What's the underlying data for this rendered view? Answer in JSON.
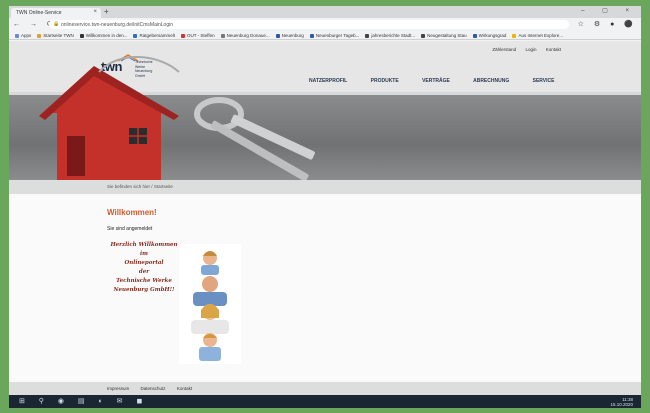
{
  "browser": {
    "tab_title": "TWN Online-Service",
    "new_tab": "+",
    "tab_close": "×",
    "window_controls": "– ▢ ×",
    "nav_icons": "← → ⟳ ⌂",
    "url": "onlineservice.twn-neuenburg.de/initCmsMainLogin",
    "extension_icons": "☆ ⚙ ● ⚫",
    "bookmarks": [
      {
        "label": "Apps",
        "color": "#6b8bd6"
      },
      {
        "label": "Startseite TWN",
        "color": "#e0a030"
      },
      {
        "label": "Willkommen in den...",
        "color": "#333333"
      },
      {
        "label": "Ratgebersammelt",
        "color": "#2f6bd0"
      },
      {
        "label": "OUT - Steffen",
        "color": "#d63030"
      },
      {
        "label": "Neuenburg Donaue...",
        "color": "#777777"
      },
      {
        "label": "Neuenburg",
        "color": "#2f5aa8"
      },
      {
        "label": "Neuenburger Tageb...",
        "color": "#2f5aa8"
      },
      {
        "label": "jahresberichte Stadt...",
        "color": "#444444"
      },
      {
        "label": "Neugestaltung Stau",
        "color": "#444444"
      },
      {
        "label": "Wirkungsgrad",
        "color": "#2f5aa8"
      },
      {
        "label": "Aus Internet Explore...",
        "color": "#f0b400"
      }
    ]
  },
  "site": {
    "utility": {
      "contact": "Zählerstand",
      "login": "Login",
      "kontakt": "Kontakt"
    },
    "logo": {
      "text": "twn",
      "subtitle": "Technische Werke Neuenburg GmbH"
    },
    "nav": [
      "NATZERPROFIL",
      "PRODUKTE",
      "VERTRÄGE",
      "ABRECHNUNG",
      "SERVICE"
    ],
    "breadcrumb": {
      "home": "Sie befinden sich hier",
      "current": "Startseite"
    },
    "content": {
      "title": "Willkommen!",
      "subtitle": "Sie sind angemeldet",
      "script_lines": [
        "Herzlich Willkommen",
        "im",
        "Onlineportal",
        "der",
        "Technische Werke",
        "Neuenburg GmbH!!"
      ]
    },
    "footer": {
      "impressum": "Impressum",
      "datenschutz": "Datenschutz",
      "kontakt": "Kontakt"
    }
  },
  "taskbar": {
    "icons": "⊞ ⚲ ◉ ▤ ◐ ✉ ◼",
    "time": "11:38",
    "date": "15.10.2020"
  },
  "colors": {
    "accent": "#d25a2c",
    "house": "#c4312a",
    "nav_text": "#2a3a52"
  }
}
